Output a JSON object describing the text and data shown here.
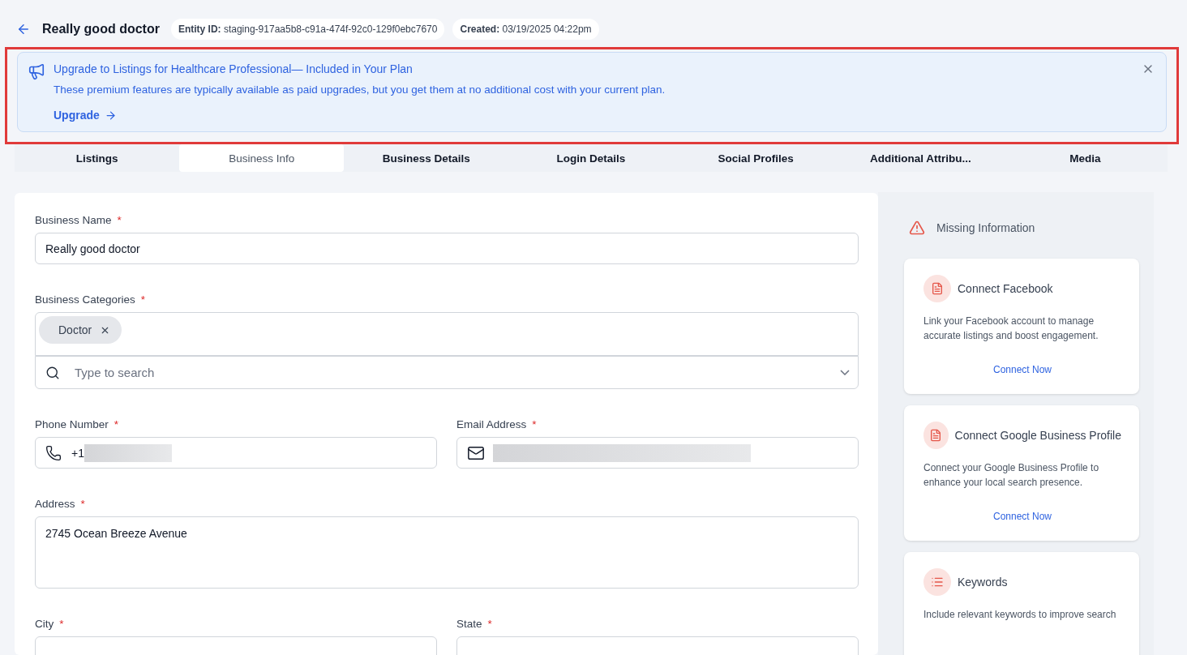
{
  "header": {
    "title": "Really good doctor",
    "entity_id": {
      "label": "Entity ID:",
      "value": "staging-917aa5b8-c91a-474f-92c0-129f0ebc7670"
    },
    "created": {
      "label": "Created:",
      "value": "03/19/2025 04:22pm"
    }
  },
  "banner": {
    "title": "Upgrade to Listings for Healthcare Professional— Included in Your Plan",
    "body": "These premium features are typically available as paid upgrades, but you get them at no additional cost with your current plan.",
    "link": "Upgrade",
    "highlighted": true
  },
  "tabs": [
    {
      "label": "Listings",
      "selected": false
    },
    {
      "label": "Business Info",
      "selected": true
    },
    {
      "label": "Business Details",
      "selected": false
    },
    {
      "label": "Login Details",
      "selected": false
    },
    {
      "label": "Social Profiles",
      "selected": false
    },
    {
      "label": "Additional Attribu...",
      "selected": false
    },
    {
      "label": "Media",
      "selected": false
    }
  ],
  "form": {
    "rows": [
      [
        {
          "kind": "text",
          "label": "Business Name",
          "required_mark": "*",
          "value": "Really good doctor"
        }
      ],
      [
        {
          "kind": "tags",
          "label": "Business Categories",
          "required_mark": "*",
          "tags": [
            "Doctor"
          ],
          "placeholder": "Type to search"
        }
      ],
      [
        {
          "kind": "phone",
          "label": "Phone Number",
          "required_mark": "*",
          "value": "+1"
        },
        {
          "kind": "email",
          "label": "Email Address",
          "required_mark": "*"
        }
      ],
      [
        {
          "kind": "textarea",
          "label": "Address",
          "required_mark": "*",
          "value": "2745 Ocean Breeze Avenue"
        }
      ],
      [
        {
          "kind": "text",
          "label": "City",
          "required_mark": "*"
        },
        {
          "kind": "text",
          "label": "State",
          "required_mark": "*"
        }
      ]
    ]
  },
  "sidebar": {
    "missing_heading": "Missing Information",
    "cards": [
      {
        "kind": "document",
        "title": "Connect Facebook",
        "body": "Link your Facebook account to manage accurate listings and boost engagement.",
        "action": "Connect Now"
      },
      {
        "kind": "document",
        "title": "Connect Google Business Profile",
        "body": "Connect your Google Business Profile to enhance your local search presence.",
        "action": "Connect Now"
      },
      {
        "kind": "list",
        "title": "Keywords",
        "body": "Include relevant keywords to improve search"
      }
    ]
  }
}
